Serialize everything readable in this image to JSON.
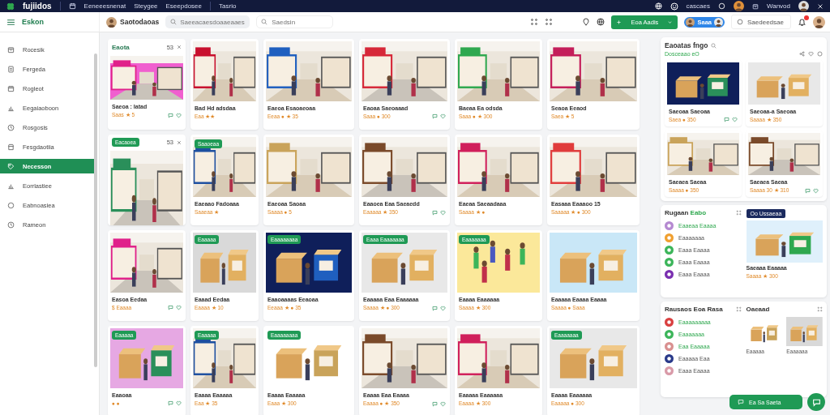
{
  "top_bar": {
    "logo": "fujiidos",
    "nav": [
      "Eeneeesnenat",
      "Steygee",
      "Eseepdosee",
      "Tasrio"
    ],
    "status": "cascaes",
    "user": "Wanvod"
  },
  "header": {
    "section": "Eskon",
    "store": "Saotodaoas",
    "search": {
      "placeholder": "Saeeacaesdoaaeaaes"
    },
    "search2": {
      "placeholder": "Saedsin"
    },
    "action_button": "Eoa Aadis",
    "profile_pill": "Saaa",
    "notice": "Saedeedsae"
  },
  "sidebar": {
    "items": [
      {
        "label": "Rocesik",
        "selected": false
      },
      {
        "label": "Fergeda",
        "selected": false
      },
      {
        "label": "Rogleot",
        "selected": false
      },
      {
        "label": "Eegaiaoboon",
        "selected": false
      },
      {
        "label": "Rosgosis",
        "selected": false
      },
      {
        "label": "Fesgdaotiia",
        "selected": false
      },
      {
        "label": "Necesson",
        "selected": true
      },
      {
        "label": "Eorrlastiee",
        "selected": false
      },
      {
        "label": "Eabnoasiea",
        "selected": false
      },
      {
        "label": "Rameon",
        "selected": false
      }
    ]
  },
  "grid": {
    "cards": [
      {
        "heading": "Eaota",
        "count": "53",
        "title": "Saeoa : Iatad",
        "meta": "Saas ★ 5"
      },
      {
        "title": "Bad Hd adsdaa",
        "meta": "Eaa ★★"
      },
      {
        "title": "Eaeoa Esaoaeoaa",
        "meta": "Eeaa ● ★ 35"
      },
      {
        "title": "Eaoaa Saeoaaad",
        "meta": "Saaa ● 300"
      },
      {
        "title": "Baeaa Ea odsda",
        "meta": "Saaa ● ★ 300"
      },
      {
        "title": "Seaoa Eeaod",
        "meta": "Saea ★ 5"
      },
      {
        "tag": "Eacaoea",
        "count": "53"
      },
      {
        "tag": "Saaoeaa",
        "title": "Eaeaao Fadoaaa",
        "meta": "Saaeaa ★"
      },
      {
        "title": "Eaeoaa Saoaa",
        "meta": "Saaaa ● 5"
      },
      {
        "title": "Eaaoea Eaa Saeaedd",
        "meta": "Eaaaaa ★ 350"
      },
      {
        "title": "Eaeaa Saeaadaaa",
        "meta": "Saaaa ★ ●"
      },
      {
        "title": "Easaaa Eaaaoo 15",
        "meta": "Saaaaa ★ ● 300"
      },
      {
        "title": "Easoa Eedaa",
        "meta": "$ Eaaaa"
      },
      {
        "tag": "Eaaaaa",
        "title": "Eaaad Eedaa",
        "meta": "Eaaaa ★ 10"
      },
      {
        "tag": "Eaaaaaaaa",
        "title": "Eaaoaaaas Eeaoaa",
        "meta": "Eeaaa ★ ● 35"
      },
      {
        "tag": "Eaaa Eaaaaaaa",
        "title": "Eaaaaa Eaa Eaaaaaa",
        "meta": "Saaaa ★ ● 300"
      },
      {
        "tag": "Eaaaaaaa",
        "title": "Eaaaa Eaaaaaa",
        "meta": "Saaaa ★ 300"
      },
      {
        "title": "Eaaaaa Eaaaa Eaaaa",
        "meta": "Saaaa ● Saaa"
      },
      {
        "tag": "Eaaaaa",
        "title": "Eaaoaa",
        "meta": "● ●"
      },
      {
        "tag": "Eaaaaa",
        "title": "Eaaaa Eaaaaa",
        "meta": "Eaa ★ 35"
      },
      {
        "tag": "Eaaaaaaaa",
        "title": "Eaaaa Eaaaaa",
        "meta": "Eaaa ★ 300"
      },
      {
        "title": "Eaaaa Eaa Eaaaa",
        "meta": "Eaaaa ● ★ 350"
      },
      {
        "title": "Eaaaaa Eaaaaaa",
        "meta": "Eaaaa ★ 300"
      },
      {
        "tag": "Eaaaaaaa",
        "title": "Eaaaa Eaaaaaa",
        "meta": "Eaaaaa ● 300"
      }
    ]
  },
  "panel": {
    "title": "Eaoatas fngo",
    "subtitle": "Dosceaao eO",
    "cards": [
      {
        "title": "Saeoaa Saeoaa",
        "meta": "Saea ● 350"
      },
      {
        "title": "Saeoaa-a Saeoaa",
        "meta": "Saaaa ★ 350"
      },
      {
        "title": "Saeaea Saeaa",
        "meta": "Saaaa ● 350"
      },
      {
        "title": "Saeaea Saeaa",
        "meta": "Saaaa 30 ★ 310"
      }
    ],
    "list": {
      "title": "Rugaan",
      "title_accent": "Eabo",
      "items": [
        {
          "label": "Eaaeaa Eaaaa",
          "color": "#b58ad1",
          "selected": true
        },
        {
          "label": "Eaaaaaaa",
          "color": "#f0a030",
          "selected": false
        },
        {
          "label": "Eaaa Eaaaa",
          "color": "#3cb55a",
          "selected": false
        },
        {
          "label": "Eaaa Eaaaa",
          "color": "#3cb55a",
          "selected": false
        },
        {
          "label": "Eaaa Eaaaa",
          "color": "#7a2fb0",
          "selected": false
        }
      ]
    },
    "featured": {
      "tag": "Oo Ussaeaa",
      "title": "Saeaaa Eaaaaa",
      "meta": "Saaaa ★ 300"
    },
    "list2": {
      "title": "Rausaos Eoa Rasa",
      "items": [
        {
          "label": "Eaaaaaaaaa",
          "color": "#d94040",
          "selected": true
        },
        {
          "label": "Eaaaaaaa",
          "color": "#3cb55a",
          "selected": true
        },
        {
          "label": "Eaa Eaaaaa",
          "color": "#d99090",
          "selected": true
        },
        {
          "label": "Eaaaaa Eaa",
          "color": "#2a3a8a",
          "selected": false
        },
        {
          "label": "Eaaa Eaaaa",
          "color": "#d99aa8",
          "selected": false
        }
      ]
    },
    "gallery": {
      "title": "Oaeaad",
      "items": [
        "Eaaaaa",
        "Eaaaaaa"
      ]
    },
    "float_button": "Ea Sa Saeta"
  }
}
